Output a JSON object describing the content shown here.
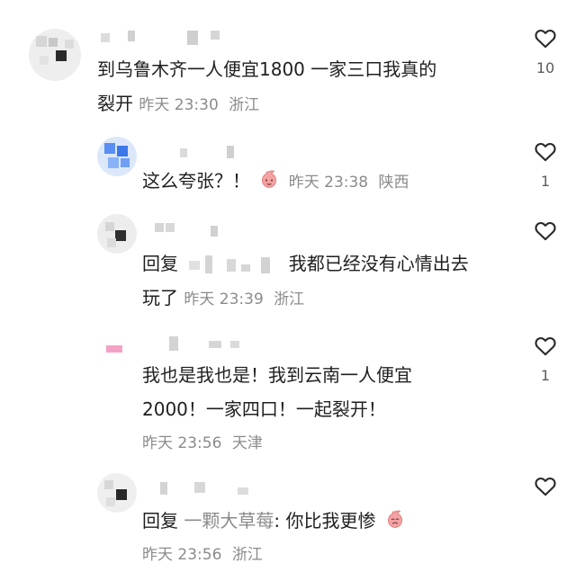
{
  "comments": [
    {
      "text_line1": "到乌鲁木齐一人便宜1800 一家三口我真的",
      "text_line2": "裂开",
      "time": "昨天 23:30",
      "location": "浙江",
      "likes": "10"
    },
    {
      "text": "这么夸张？！",
      "time": "昨天 23:38",
      "location": "陕西",
      "likes": "1"
    },
    {
      "reply_prefix": "回复",
      "text_line1": "我都已经没有心情出去",
      "text_line2": "玩了",
      "time": "昨天 23:39",
      "location": "浙江"
    },
    {
      "text_line1": "我也是我也是！我到云南一人便宜",
      "text_line2": "2000！一家四口！一起裂开！",
      "time": "昨天 23:56",
      "location": "天津",
      "likes": "1"
    },
    {
      "reply_prefix": "回复",
      "reply_target": "一颗大草莓",
      "text": ": 你比我更惨",
      "time": "昨天 23:56",
      "location": "浙江"
    }
  ],
  "icons": {
    "like": "heart-outline-icon",
    "emoji": "peach-face-emoji-icon"
  },
  "colors": {
    "text": "#1f1f1f",
    "meta": "#8b8b8b",
    "heart": "#2a2a2a",
    "emoji_peach": "#f4a3a3"
  }
}
